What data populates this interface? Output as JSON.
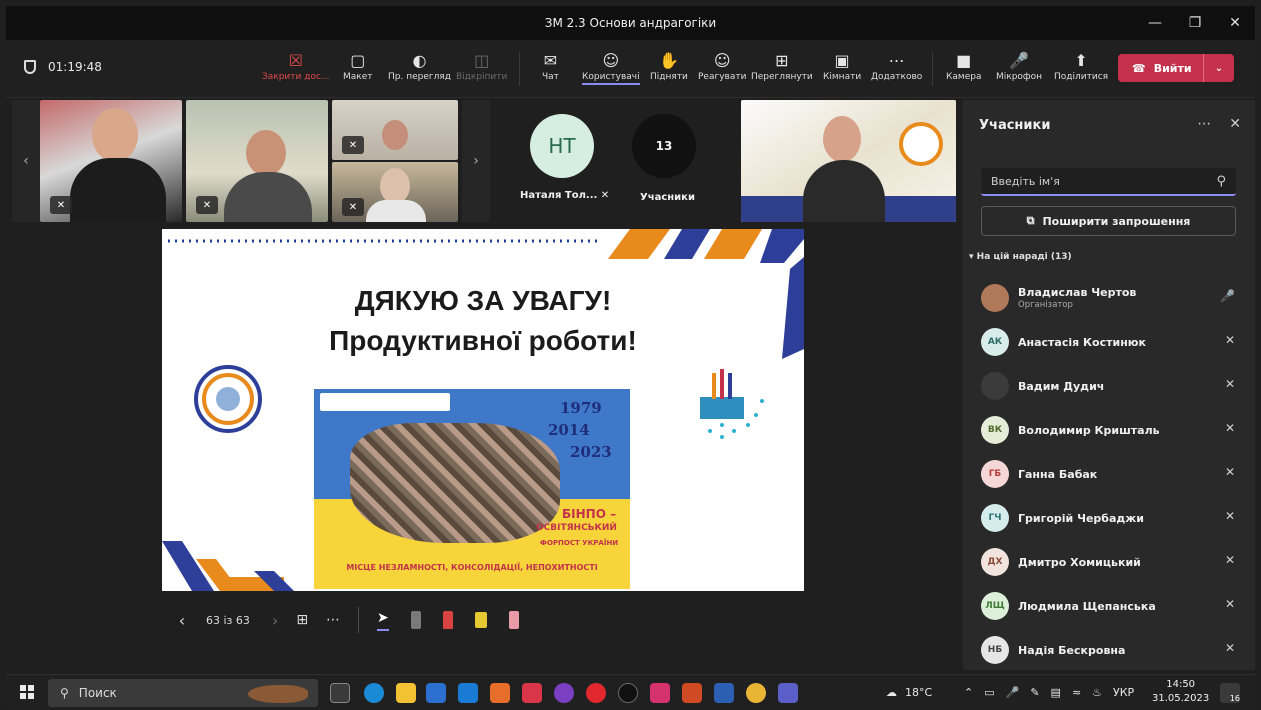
{
  "window": {
    "title": "ЗМ 2.3 Основи андрагогіки"
  },
  "toolbar": {
    "timer": "01:19:48",
    "items": [
      {
        "label": "Закрити дос...",
        "icon": "close-share-icon"
      },
      {
        "label": "Макет",
        "icon": "layout-icon"
      },
      {
        "label": "Пр. перегляд",
        "icon": "eye-icon"
      },
      {
        "label": "Відкріпити",
        "icon": "unpin-icon"
      },
      {
        "label": "Чат",
        "icon": "chat-icon"
      },
      {
        "label": "Користувачі",
        "icon": "people-icon"
      },
      {
        "label": "Підняти",
        "icon": "raise-hand-icon"
      },
      {
        "label": "Реагувати",
        "icon": "smile-icon"
      },
      {
        "label": "Переглянути",
        "icon": "view-icon"
      },
      {
        "label": "Кімнати",
        "icon": "rooms-icon"
      },
      {
        "label": "Додатково",
        "icon": "more-icon"
      },
      {
        "label": "Камера",
        "icon": "camera-icon"
      },
      {
        "label": "Мікрофон",
        "icon": "mic-icon"
      },
      {
        "label": "Поділитися",
        "icon": "share-icon"
      }
    ],
    "leave_label": "Вийти"
  },
  "strip": {
    "tile_name": "Наталя Тол...",
    "tile_initials": "НТ",
    "count": "13",
    "count_label": "Учасники"
  },
  "slide": {
    "line1": "ДЯКУЮ ЗА УВАГУ!",
    "line2": "Продуктивної роботи!",
    "years": [
      "1979",
      "2014",
      "2023"
    ],
    "brand": "БІНПО –",
    "brand2": "ОСВІТЯНСЬКИЙ",
    "brand3": "ФОРПОСТ УКРАЇНИ",
    "motto": "МІСЦЕ НЕЗЛАМНОСТІ, КОНСОЛІДАЦІЇ, НЕПОХИТНОСТІ"
  },
  "slide_controls": {
    "page": "63 із 63"
  },
  "panel": {
    "title": "Учасники",
    "search_placeholder": "Введіть ім'я",
    "invite_label": "Поширити запрошення",
    "group_label": "На цій нараді (13)",
    "participants": [
      {
        "name": "Владислав Чертов",
        "role": "Організатор",
        "initials": "",
        "bg": "#b07a5a",
        "fg": "#ffffff",
        "mic": "mic-on"
      },
      {
        "name": "Анастасія Костинюк",
        "role": "",
        "initials": "АК",
        "bg": "#d8ece9",
        "fg": "#2d6b66",
        "mic": "mic-off"
      },
      {
        "name": "Вадим Дудич",
        "role": "",
        "initials": "",
        "bg": "#3b3b3b",
        "fg": "#ffffff",
        "mic": "mic-off"
      },
      {
        "name": "Володимир Кришталь",
        "role": "",
        "initials": "ВК",
        "bg": "#e5ecd7",
        "fg": "#4d6a2a",
        "mic": "mic-off"
      },
      {
        "name": "Ганна Бабак",
        "role": "",
        "initials": "ГБ",
        "bg": "#f4d7d6",
        "fg": "#b3403c",
        "mic": "mic-off"
      },
      {
        "name": "Григорій Чербаджи",
        "role": "",
        "initials": "ГЧ",
        "bg": "#d6ecec",
        "fg": "#2d7474",
        "mic": "mic-off"
      },
      {
        "name": "Дмитро Хомицький",
        "role": "",
        "initials": "ДХ",
        "bg": "#f1e3de",
        "fg": "#8a4b3a",
        "mic": "mic-off"
      },
      {
        "name": "Людмила Щепанська",
        "role": "",
        "initials": "ЛЩ",
        "bg": "#dcefd9",
        "fg": "#3b7a33",
        "mic": "mic-off"
      },
      {
        "name": "Надія Бескровна",
        "role": "",
        "initials": "НБ",
        "bg": "#e6e6e6",
        "fg": "#444444",
        "mic": "mic-off"
      }
    ]
  },
  "taskbar": {
    "search_label": "Поиск",
    "weather": "18°C",
    "lang": "УКР",
    "time": "14:50",
    "date": "31.05.2023",
    "notifications": "16"
  },
  "colors": {
    "accent": "#8b8cf0",
    "leave": "#c4314b",
    "danger": "#e04a4a"
  }
}
